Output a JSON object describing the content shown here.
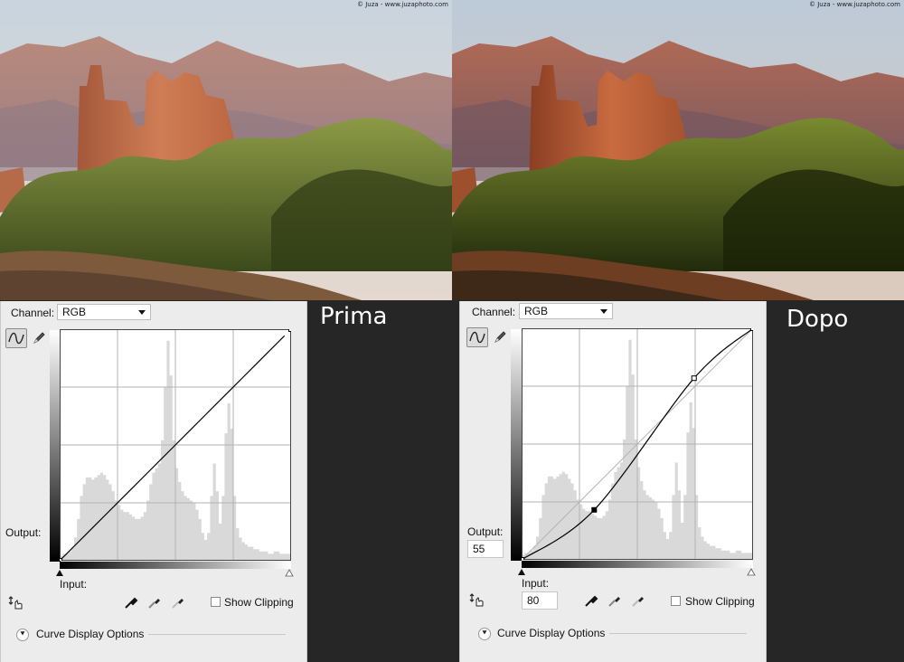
{
  "credit": "© Juza - www.juzaphoto.com",
  "panels": [
    {
      "caption": "Prima",
      "channel_label": "Channel:",
      "channel_value": "RGB",
      "output_label": "Output:",
      "output_value": "",
      "input_label": "Input:",
      "input_value": "",
      "show_clipping": "Show Clipping",
      "curve_display": "Curve Display Options",
      "curve_points": [
        [
          0,
          0
        ],
        [
          255,
          255
        ]
      ]
    },
    {
      "caption": "Dopo",
      "channel_label": "Channel:",
      "channel_value": "RGB",
      "output_label": "Output:",
      "output_value": "55",
      "input_label": "Input:",
      "input_value": "80",
      "show_clipping": "Show Clipping",
      "curve_display": "Curve Display Options",
      "curve_points": [
        [
          0,
          0
        ],
        [
          80,
          55
        ],
        [
          190,
          200
        ],
        [
          255,
          255
        ]
      ]
    }
  ],
  "histogram": [
    2,
    3,
    3,
    4,
    6,
    10,
    18,
    28,
    33,
    36,
    36,
    35,
    36,
    37,
    38,
    37,
    35,
    33,
    30,
    26,
    24,
    22,
    21,
    21,
    20,
    19,
    18,
    18,
    19,
    21,
    26,
    33,
    38,
    40,
    42,
    52,
    75,
    95,
    80,
    52,
    40,
    34,
    30,
    28,
    27,
    26,
    25,
    22,
    18,
    12,
    9,
    12,
    28,
    42,
    30,
    16,
    28,
    55,
    68,
    57,
    28,
    14,
    10,
    8,
    7,
    6,
    6,
    5,
    5,
    4,
    4,
    4,
    3,
    3,
    4,
    4,
    3,
    3,
    3,
    3
  ],
  "colors": {
    "background": "#262626",
    "panel": "#ececec",
    "histogram": "#d9d9d9",
    "grid": "#b3b3b3"
  }
}
